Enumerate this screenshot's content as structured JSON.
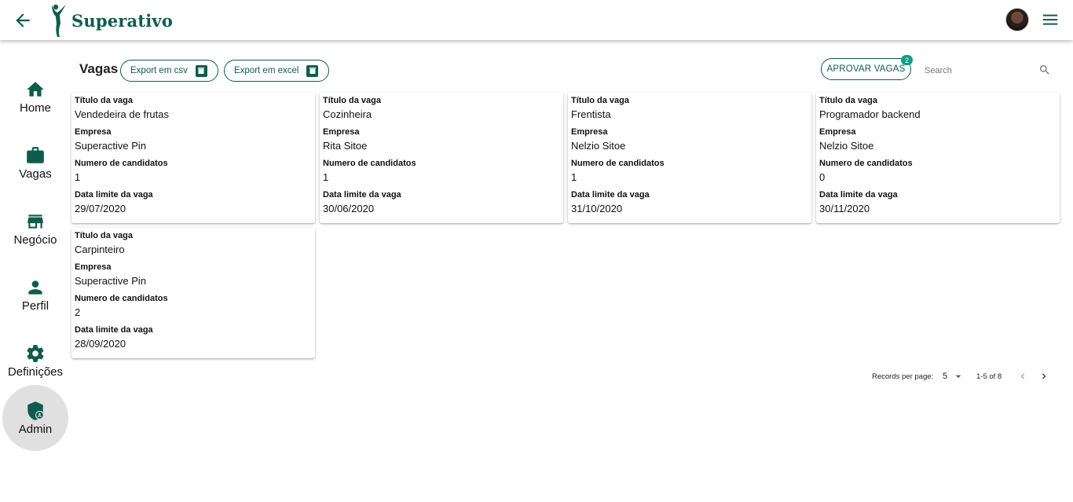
{
  "app": {
    "name": "Superativo"
  },
  "nav": {
    "items": [
      {
        "label": "Home",
        "icon": "home-icon"
      },
      {
        "label": "Vagas",
        "icon": "briefcase-icon"
      },
      {
        "label": "Negócio",
        "icon": "store-icon"
      },
      {
        "label": "Perfil",
        "icon": "person-icon"
      },
      {
        "label": "Definições",
        "icon": "gear-icon"
      },
      {
        "label": "Admin",
        "icon": "admin-shield-icon"
      }
    ],
    "active": "Admin"
  },
  "main": {
    "title": "Vagas",
    "export_csv_label": "Export em csv",
    "export_excel_label": "Export em excel",
    "approve_label": "APROVAR VAGAS",
    "approve_badge": "2",
    "search_placeholder": "Search"
  },
  "card_labels": {
    "title": "Título da vaga",
    "company": "Empresa",
    "candidates": "Numero de candidatos",
    "deadline": "Data limite da vaga"
  },
  "cards": [
    {
      "title": "Vendedeira de frutas",
      "company": "Superactive Pin",
      "candidates": "1",
      "deadline": "29/07/2020"
    },
    {
      "title": "Cozinheira",
      "company": "Rita Sitoe",
      "candidates": "1",
      "deadline": "30/06/2020"
    },
    {
      "title": "Frentista",
      "company": "Nelzio Sitoe",
      "candidates": "1",
      "deadline": "31/10/2020"
    },
    {
      "title": "Programador backend",
      "company": "Nelzio Sitoe",
      "candidates": "0",
      "deadline": "30/11/2020"
    },
    {
      "title": "Carpinteiro",
      "company": "Superactive Pin",
      "candidates": "2",
      "deadline": "28/09/2020"
    }
  ],
  "pagination": {
    "records_label": "Records per page:",
    "per_page": "5",
    "range": "1-5 of 8"
  },
  "colors": {
    "brand": "#0f5c4c",
    "badge": "#0f9d85",
    "active_nav_bg": "#e0e0e0"
  }
}
